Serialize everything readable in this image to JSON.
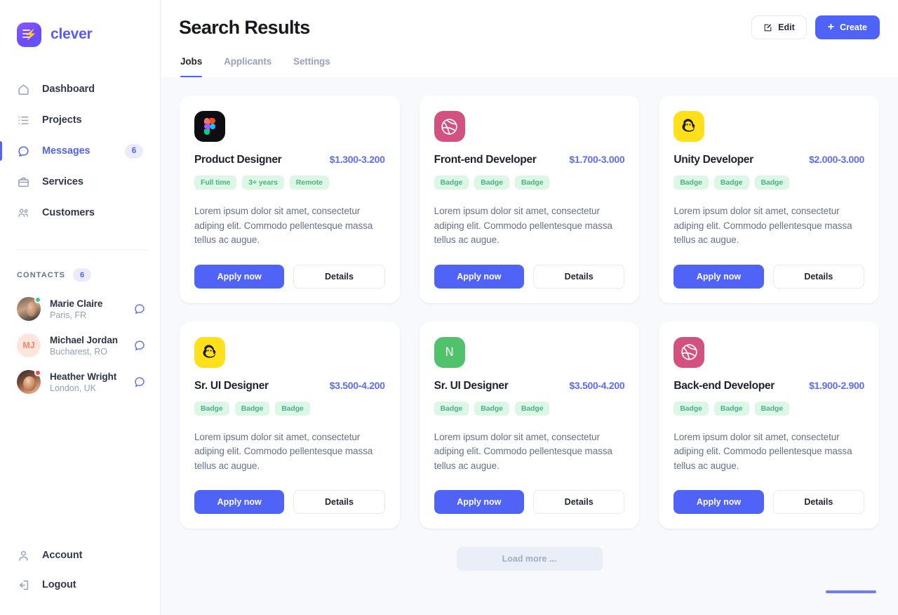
{
  "brand": {
    "name": "clever",
    "logo_icon": "bolt-icon"
  },
  "sidebar": {
    "nav": [
      {
        "label": "Dashboard",
        "icon": "home-icon",
        "badge": null,
        "active": false
      },
      {
        "label": "Projects",
        "icon": "list-icon",
        "badge": null,
        "active": false
      },
      {
        "label": "Messages",
        "icon": "chat-bubble-icon",
        "badge": "6",
        "active": true
      },
      {
        "label": "Services",
        "icon": "briefcase-icon",
        "badge": null,
        "active": false
      },
      {
        "label": "Customers",
        "icon": "users-icon",
        "badge": null,
        "active": false
      }
    ],
    "contacts_title": "CONTACTS",
    "contacts_count": "6",
    "contacts": [
      {
        "name": "Marie Claire",
        "location": "Paris, FR",
        "avatar": "photo",
        "status": "online",
        "status_color": "#34d07f",
        "chat_icon": "chat-bubble-icon"
      },
      {
        "name": "Michael Jordan",
        "location": "Bucharest, RO",
        "avatar": "initials",
        "initials": "MJ",
        "status": null,
        "chat_icon": "chat-bubble-icon"
      },
      {
        "name": "Heather Wright",
        "location": "London, UK",
        "avatar": "photo",
        "status": "busy",
        "status_color": "#f4474f",
        "chat_icon": "chat-bubble-icon"
      }
    ],
    "bottom": [
      {
        "label": "Account",
        "icon": "user-icon"
      },
      {
        "label": "Logout",
        "icon": "logout-icon"
      }
    ]
  },
  "header": {
    "title": "Search Results",
    "edit_label": "Edit",
    "edit_icon": "pencil-square-icon",
    "create_label": "Create",
    "create_icon": "plus-icon",
    "tabs": [
      {
        "label": "Jobs",
        "active": true
      },
      {
        "label": "Applicants",
        "active": false
      },
      {
        "label": "Settings",
        "active": false
      }
    ]
  },
  "colors": {
    "accent": "#4f63f7",
    "salary": "#5b6cf7",
    "badge_bg": "#dcf7e6",
    "badge_text": "#4cb286",
    "page_bg": "#f7f9fc"
  },
  "cards": [
    {
      "logo": "figma-logo-icon",
      "logo_style": "figma",
      "title": "Product Designer",
      "salary": "$1.300-3.200",
      "badges": [
        "Full time",
        "3+ years",
        "Remote"
      ],
      "description": "Lorem ipsum dolor sit amet, consectetur adiping elit. Commodo pellentesque massa tellus ac augue.",
      "apply_label": "Apply now",
      "details_label": "Details"
    },
    {
      "logo": "dribbble-logo-icon",
      "logo_style": "dribbble",
      "title": "Front-end Developer",
      "salary": "$1.700-3.000",
      "badges": [
        "Badge",
        "Badge",
        "Badge"
      ],
      "description": "Lorem ipsum dolor sit amet, consectetur adiping elit. Commodo pellentesque massa tellus ac augue.",
      "apply_label": "Apply now",
      "details_label": "Details"
    },
    {
      "logo": "mailchimp-logo-icon",
      "logo_style": "mailchimp",
      "title": "Unity Developer",
      "salary": "$2.000-3.000",
      "badges": [
        "Badge",
        "Badge",
        "Badge"
      ],
      "description": "Lorem ipsum dolor sit amet, consectetur adiping elit. Commodo pellentesque massa tellus ac augue.",
      "apply_label": "Apply now",
      "details_label": "Details"
    },
    {
      "logo": "mailchimp-logo-icon",
      "logo_style": "mailchimp",
      "title": "Sr. UI Designer",
      "salary": "$3.500-4.200",
      "badges": [
        "Badge",
        "Badge",
        "Badge"
      ],
      "description": "Lorem ipsum dolor sit amet, consectetur adiping elit. Commodo pellentesque massa tellus ac augue.",
      "apply_label": "Apply now",
      "details_label": "Details"
    },
    {
      "logo": "notion-logo-icon",
      "logo_style": "notion",
      "logo_letter": "N",
      "title": "Sr. UI Designer",
      "salary": "$3.500-4.200",
      "badges": [
        "Badge",
        "Badge",
        "Badge"
      ],
      "description": "Lorem ipsum dolor sit amet, consectetur adiping elit. Commodo pellentesque massa tellus ac augue.",
      "apply_label": "Apply now",
      "details_label": "Details"
    },
    {
      "logo": "dribbble-logo-icon",
      "logo_style": "dribbble",
      "title": "Back-end Developer",
      "salary": "$1.900-2.900",
      "badges": [
        "Badge",
        "Badge",
        "Badge"
      ],
      "description": "Lorem ipsum dolor sit amet, consectetur adiping elit. Commodo pellentesque massa tellus ac augue.",
      "apply_label": "Apply now",
      "details_label": "Details"
    }
  ],
  "footer": {
    "load_more_label": "Load more ..."
  }
}
